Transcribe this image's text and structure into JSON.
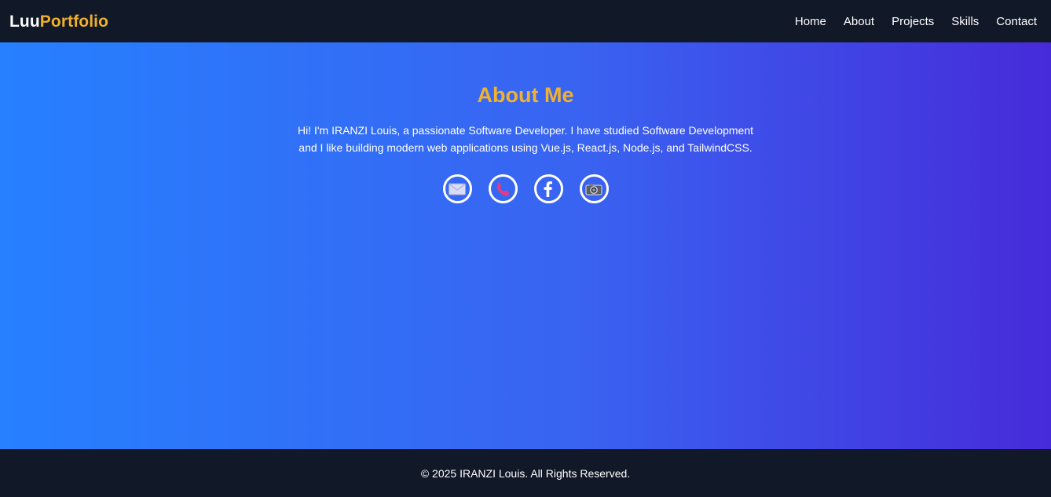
{
  "brand": {
    "part1": "Luu",
    "part2": "Portfolio",
    "color_primary": "#ffffff",
    "color_accent": "#f0b02a"
  },
  "nav": {
    "items": [
      {
        "label": "Home"
      },
      {
        "label": "About"
      },
      {
        "label": "Projects"
      },
      {
        "label": "Skills"
      },
      {
        "label": "Contact"
      }
    ]
  },
  "about": {
    "title": "About Me",
    "text": "Hi! I'm IRANZI Louis, a passionate Software Developer. I have studied Software Development and I like building modern web applications using Vue.js, React.js, Node.js, and TailwindCSS.",
    "social": [
      {
        "icon": "mail-icon"
      },
      {
        "icon": "phone-icon"
      },
      {
        "icon": "facebook-icon"
      },
      {
        "icon": "camera-icon"
      }
    ]
  },
  "footer": {
    "text": "© 2025 IRANZI Louis. All Rights Reserved."
  }
}
